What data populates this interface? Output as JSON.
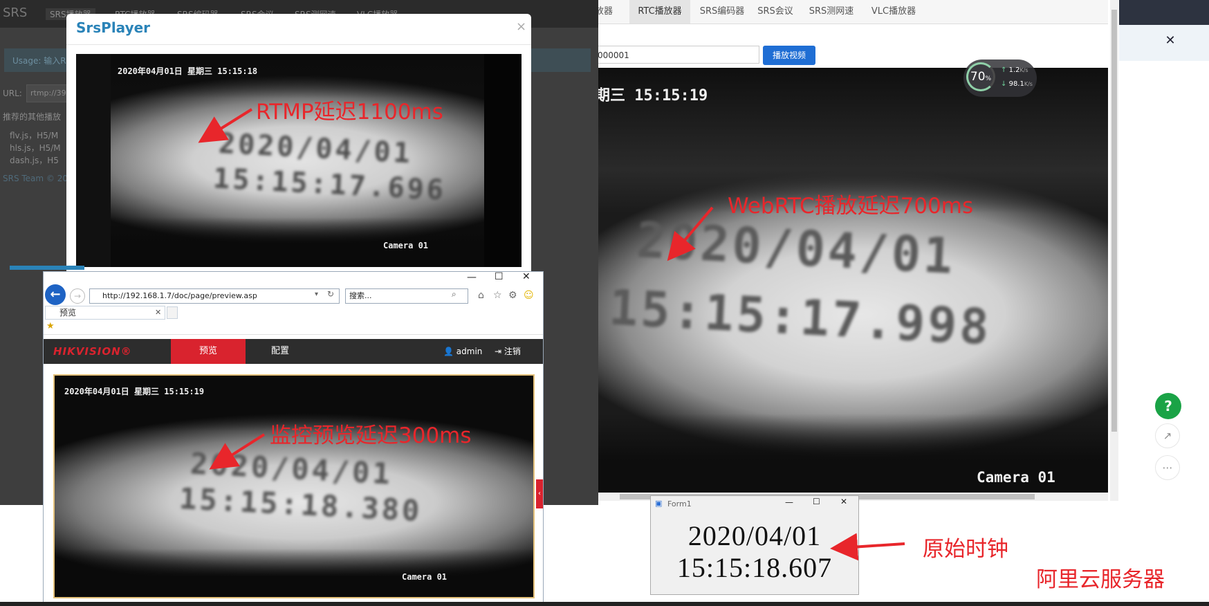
{
  "srs_rtc_page": {
    "nav_tabs": [
      "放器",
      "RTC播放器",
      "SRS编码器",
      "SRS会议",
      "SRS测网速",
      "VLC播放器"
    ],
    "url_value": "000001",
    "play_button": "播放视频",
    "video": {
      "osd_datetime": "期三  15:15:19",
      "clock_date": "2020/04/01",
      "clock_time": "15:15:17.998",
      "camera_label": "Camera 01"
    }
  },
  "speed_widget": {
    "percent": "70",
    "unit": "%",
    "upload": "1.2",
    "download": "98.1",
    "rate_unit": "K/s"
  },
  "background_srs_page": {
    "brand": "SRS",
    "nav_tabs": [
      "SRS播放器",
      "RTC播放器",
      "SRS编码器",
      "SRS会议",
      "SRS测网速",
      "VLC播放器"
    ],
    "usage_text": "Usage: 输入R",
    "url_label": "URL:",
    "url_value": "rtmp://39",
    "recommend_text": "推荐的其他播放",
    "links": [
      "flv.js，H5/M",
      "hls.js，H5/M",
      "dash.js，H5"
    ],
    "footer": "SRS Team © 20"
  },
  "srs_player_modal": {
    "title": "SrsPlayer",
    "close": "×",
    "video": {
      "osd_datetime": "2020年04月01日  星期三  15:15:18",
      "clock_date": "2020/04/01",
      "clock_time": "15:15:17.696",
      "camera_label": "Camera 01"
    }
  },
  "ie_window": {
    "address": "http://192.168.1.7/doc/page/preview.asp",
    "search_placeholder": "搜索...",
    "tab_title": "预览",
    "hikvision": {
      "logo": "HIKVISION®",
      "nav_preview": "预览",
      "nav_config": "配置",
      "user": "admin",
      "logout": "注销",
      "video": {
        "osd_datetime": "2020年04月01日  星期三  15:15:19",
        "clock_date": "2020/04/01",
        "clock_time": "15:15:18.380",
        "camera_label": "Camera 01"
      }
    }
  },
  "form1": {
    "title": "Form1",
    "date": "2020/04/01",
    "time": "15:15:18.607"
  },
  "annotations": {
    "rtmp": "RTMP延迟1100ms",
    "webrtc": "WebRTC播放延迟700ms",
    "monitor": "监控预览延迟300ms",
    "original_clock": "原始时钟",
    "server": "阿里云服务器"
  },
  "floating_buttons": {
    "help": "?"
  },
  "colors": {
    "annotation_red": "#e8262b",
    "hik_red": "#d9232e",
    "srs_blue": "#2a83b8",
    "play_button_blue": "#1f6ed4",
    "help_green": "#1aa346"
  }
}
